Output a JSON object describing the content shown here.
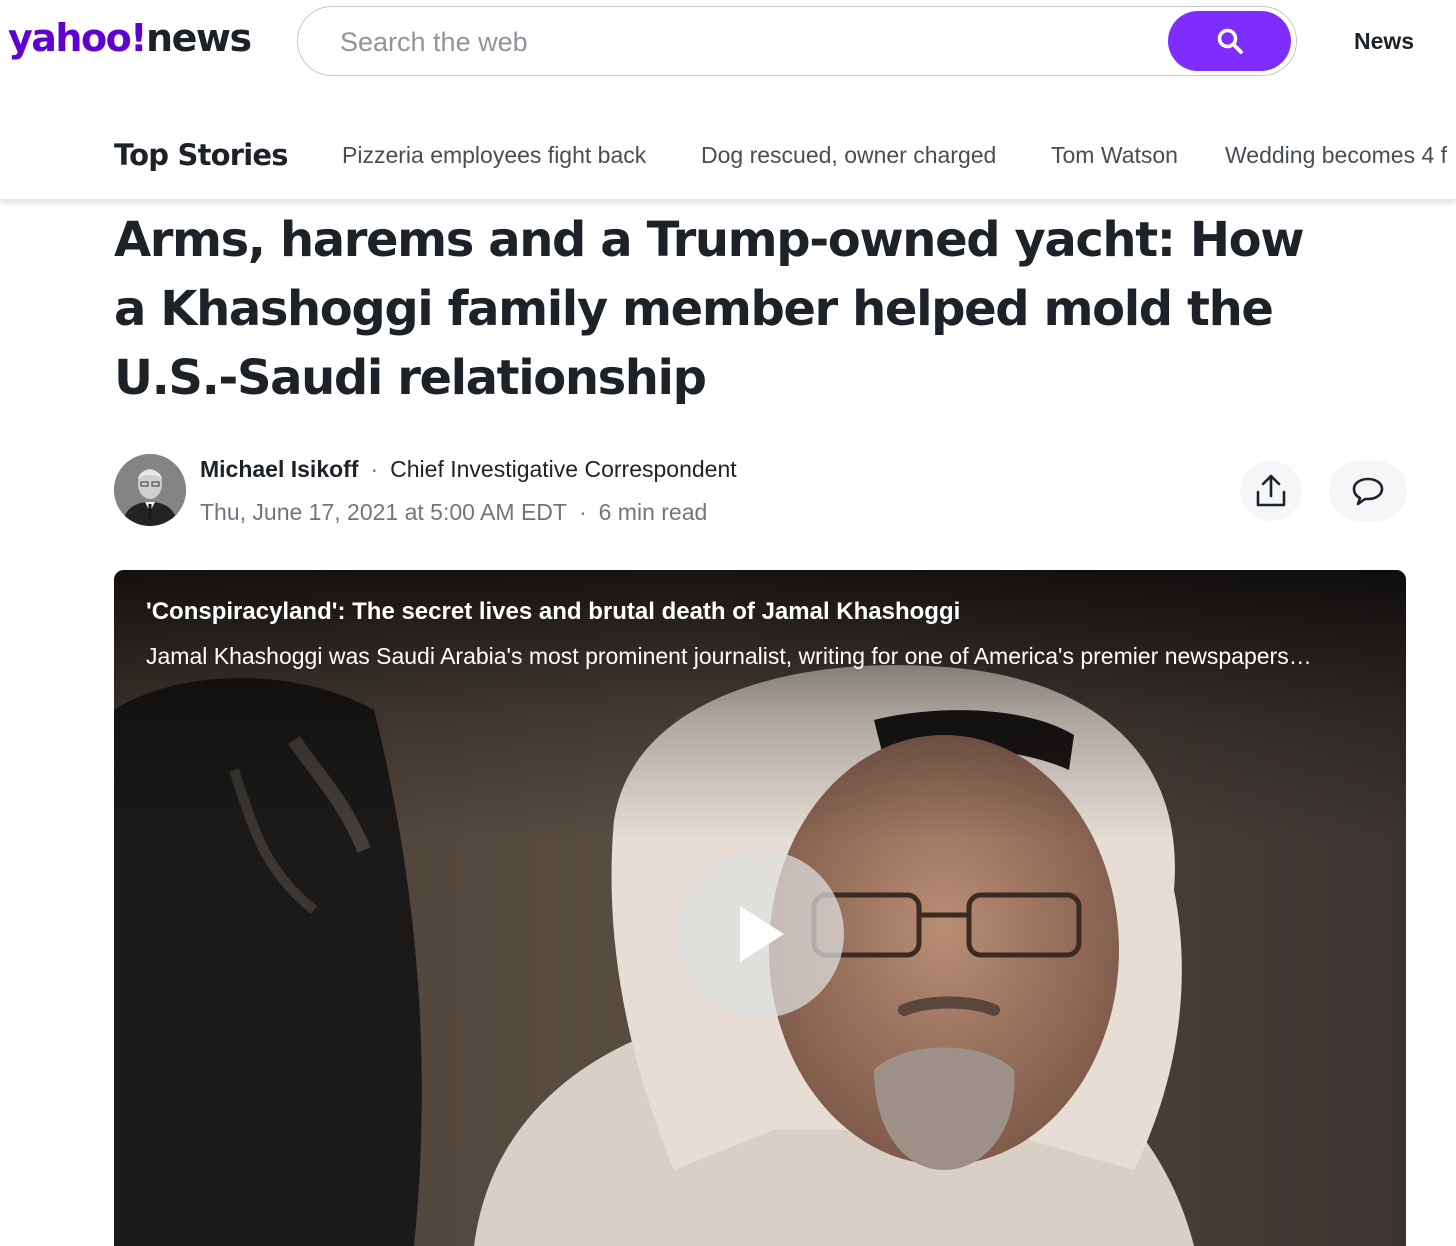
{
  "header": {
    "logo_brand": "yahoo!",
    "logo_section": "news",
    "search_placeholder": "Search the web",
    "search_button_icon": "search-icon",
    "top_link": "News",
    "brand_color": "#6001d2",
    "search_button_color": "#7d2eff"
  },
  "subnav": {
    "section": "Top Stories",
    "trending": [
      "Pizzeria employees fight back",
      "Dog rescued, owner charged",
      "Tom Watson",
      "Wedding becomes 4 f"
    ]
  },
  "article": {
    "headline": "Arms, harems and a Trump-owned yacht: How a Khashoggi family member helped mold the U.S.-Saudi relationship",
    "author": {
      "name": "Michael Isikoff",
      "role": "Chief Investigative Correspondent",
      "avatar_icon": "author-avatar"
    },
    "date": "Thu, June 17, 2021 at 5:00 AM EDT",
    "read_time": "6 min read",
    "actions": {
      "share_icon": "share-icon",
      "comment_icon": "comment-icon"
    }
  },
  "video": {
    "title": "'Conspiracyland': The secret lives and brutal death of Jamal Khashoggi",
    "description": "Jamal Khashoggi was Saudi Arabia's most prominent journalist, writing for one of America's premier newspapers…",
    "play_icon": "play-icon"
  }
}
